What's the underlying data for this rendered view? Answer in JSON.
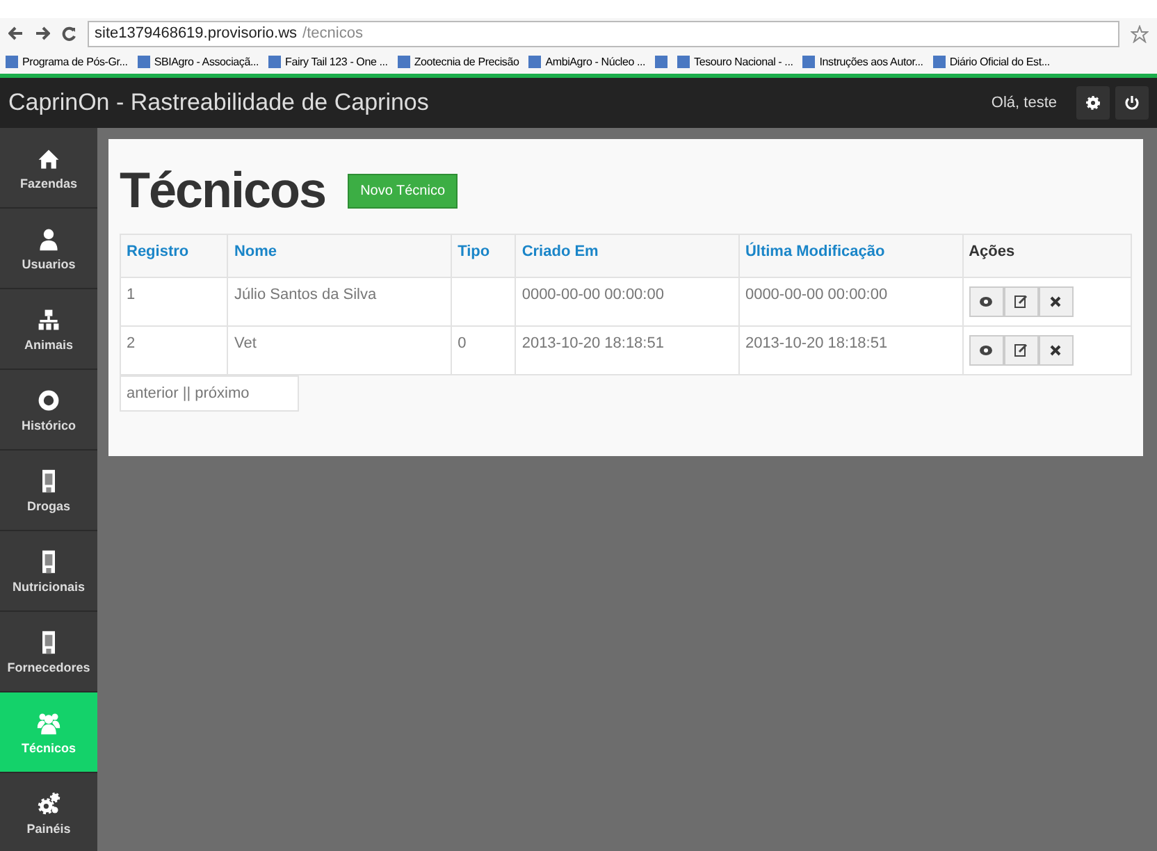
{
  "browser": {
    "url_host": "site1379468619.provisorio.ws",
    "url_path": "/tecnicos",
    "bookmarks": [
      {
        "kind": "link",
        "label": "Programa de Pós-Gr..."
      },
      {
        "kind": "link",
        "label": "SBIAgro - Associaçã..."
      },
      {
        "kind": "link",
        "label": "Fairy Tail 123 - One ..."
      },
      {
        "kind": "link",
        "label": "Zootecnia de Precisão"
      },
      {
        "kind": "link",
        "label": "AmbiAgro - Núcleo ..."
      },
      {
        "kind": "icon"
      },
      {
        "kind": "link",
        "label": "Tesouro Nacional - ..."
      },
      {
        "kind": "link",
        "label": "Instruções aos Autor..."
      },
      {
        "kind": "link",
        "label": "Diário Oficial do Est..."
      }
    ]
  },
  "navbar": {
    "title": "CaprinOn - Rastreabilidade de Caprinos",
    "greeting": "Olá, teste"
  },
  "sidebar": {
    "items": [
      {
        "label": "Fazendas",
        "kind": "home",
        "selected": false
      },
      {
        "label": "Usuarios",
        "kind": "user",
        "selected": false
      },
      {
        "label": "Animais",
        "kind": "sitemap",
        "selected": false
      },
      {
        "label": "Histórico",
        "kind": "eye",
        "selected": false
      },
      {
        "label": "Drogas",
        "kind": "building",
        "selected": false
      },
      {
        "label": "Nutricionais",
        "kind": "building",
        "selected": false
      },
      {
        "label": "Fornecedores",
        "kind": "building",
        "selected": false
      },
      {
        "label": "Técnicos",
        "kind": "group",
        "selected": true
      },
      {
        "label": "Painéis",
        "kind": "cogs",
        "selected": false
      }
    ]
  },
  "page": {
    "title": "Técnicos",
    "new_button": "Novo Técnico"
  },
  "table": {
    "columns": [
      "Registro",
      "Nome",
      "Tipo",
      "Criado Em",
      "Última Modificação",
      "Ações"
    ],
    "rows": [
      {
        "cells": [
          "1",
          "Júlio Santos da Silva",
          "",
          "0000-00-00 00:00:00",
          "0000-00-00 00:00:00"
        ]
      },
      {
        "cells": [
          "2",
          "Vet",
          "0",
          "2013-10-20 18:18:51",
          "2013-10-20 18:18:51"
        ]
      }
    ],
    "pagination": "anterior || próximo"
  }
}
